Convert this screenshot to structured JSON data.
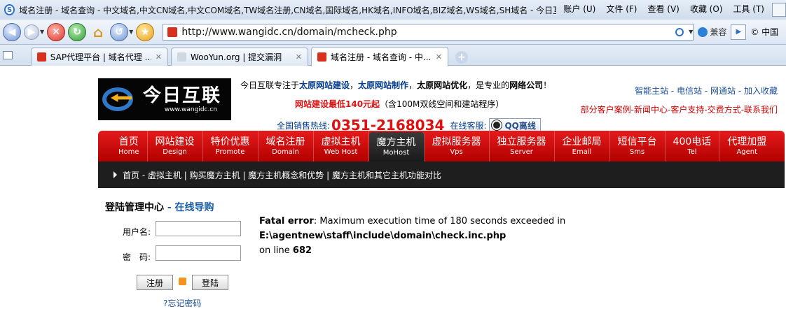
{
  "window": {
    "title": "域名注册 - 域名查询 - 中文域名,中文CN域名,中文COM域名,TW域名注册,CN域名,国际域名,HK域名,INFO域名,BIZ域名,WS域名,SH域名 - 今日互联 -...",
    "menu": [
      "账户 (U)",
      "文件 (F)",
      "查看 (V)",
      "收藏 (O)",
      "工具 (T)"
    ]
  },
  "toolbar": {
    "url": "http://www.wangidc.cn/domain/mcheck.php",
    "compat_label": "兼容",
    "cutoff_text": "© 中国"
  },
  "tabs": [
    {
      "label": "SAP代理平台 | 域名代理 ..."
    },
    {
      "label": "WooYun.org | 提交漏洞"
    },
    {
      "label": "域名注册 - 域名查询 - 中..."
    }
  ],
  "header": {
    "logo_brand": "今日互联",
    "logo_domain": "www.wangidc.cn",
    "intro_prefix": "今日互联专注于",
    "intro_a": "太原网站建设",
    "intro_sep1": "，",
    "intro_b": "太原网站制作",
    "intro_sep2": "，",
    "intro_c": "太原网站优化",
    "intro_mid": "，是专业的",
    "intro_d": "网络公司",
    "intro_end": "！",
    "price_red": "网站建设最低140元起",
    "price_rest": "（含100M双线空间和建站程序）",
    "hotline_label": "全国销售热线:",
    "hotline_number": "0351-2168034",
    "online_label": "在线客服:",
    "qq_label": "QQ离线",
    "toplinks": "智能主站 - 电信站 - 网通站 - 加入收藏",
    "toplinks2": "部分客户案例-新闻中心-客户支持-交费方式-联系我们"
  },
  "nav": {
    "items": [
      {
        "cn": "首页",
        "en": "Home"
      },
      {
        "cn": "网站建设",
        "en": "Design"
      },
      {
        "cn": "特价优惠",
        "en": "Promote"
      },
      {
        "cn": "域名注册",
        "en": "Domain"
      },
      {
        "cn": "虚拟主机",
        "en": "Web Host"
      },
      {
        "cn": "魔方主机",
        "en": "MoHost"
      },
      {
        "cn": "虚拟服务器",
        "en": "Vps"
      },
      {
        "cn": "独立服务器",
        "en": "Server"
      },
      {
        "cn": "企业邮局",
        "en": "Email"
      },
      {
        "cn": "短信平台",
        "en": "Sms"
      },
      {
        "cn": "400电话",
        "en": "Tel"
      },
      {
        "cn": "代理加盟",
        "en": "Agent"
      }
    ],
    "sublinks": "首页 - 虚拟主机 | 购买魔方主机 | 魔方主机概念和优势 | 魔方主机和其它主机功能对比"
  },
  "login": {
    "title": "登陆管理中心",
    "guide": " - 在线导购",
    "username_label": "用户名:",
    "password_label": "密　码:",
    "register_button": "注册",
    "login_button": "登陆",
    "forgot": "?忘记密码"
  },
  "error": {
    "label": "Fatal error",
    "message": ": Maximum execution time of 180 seconds exceeded in ",
    "path": "E:\\agentnew\\staff\\include\\domain\\check.inc.php",
    "line_text": " on line ",
    "line_number": "682"
  }
}
